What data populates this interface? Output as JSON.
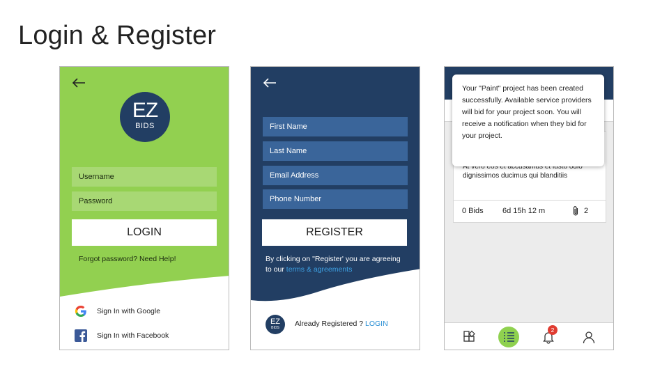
{
  "slide": {
    "title": "Login & Register"
  },
  "colors": {
    "green": "#92d050",
    "navy": "#223e63",
    "field_blue": "#3a659a",
    "link_blue": "#3ea3e6",
    "badge_red": "#e03c31"
  },
  "login_screen": {
    "back_icon": "back-arrow-icon",
    "logo": {
      "top": "EZ",
      "bottom": "BIDS"
    },
    "username_placeholder": "Username",
    "password_placeholder": "Password",
    "login_button": "LOGIN",
    "forgot_text": "Forgot password? Need Help!",
    "social": [
      {
        "icon": "google-icon",
        "label": "Sign In with Google"
      },
      {
        "icon": "facebook-icon",
        "label": "Sign In with Facebook"
      }
    ]
  },
  "register_screen": {
    "back_icon": "back-arrow-icon",
    "fields": [
      "First Name",
      "Last Name",
      "Email Address",
      "Phone Number"
    ],
    "register_button": "REGISTER",
    "terms_prefix": "By clicking on \"Register' you are agreeing to our ",
    "terms_link": "terms & agreements",
    "mini_logo": {
      "top": "EZ",
      "bottom": "BIDS"
    },
    "already_text": "Already Registered ? ",
    "already_link": "LOGIN"
  },
  "project_screen": {
    "toast": "Your \"Paint\" project has been created successfully.  Available service providers will bid for your project soon. You will receive a notification when they bid for your project.",
    "card_text": "At vero eos et accusamus et iusto odio dignissimos ducimus qui blanditiis",
    "bids": "0 Bids",
    "time_left": "6d 15h 12 m",
    "attachments": "2",
    "tabs": [
      {
        "icon": "add-widget-icon"
      },
      {
        "icon": "list-icon",
        "active": true
      },
      {
        "icon": "bell-icon",
        "badge": "2"
      },
      {
        "icon": "user-icon"
      }
    ]
  }
}
